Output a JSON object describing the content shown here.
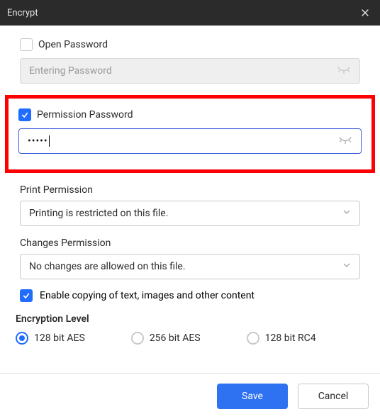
{
  "titlebar": {
    "title": "Encrypt"
  },
  "open_pw": {
    "label": "Open Password",
    "checked": false,
    "placeholder": "Entering Password",
    "value": ""
  },
  "perm_pw": {
    "label": "Permission Password",
    "checked": true,
    "value": "•••••"
  },
  "print_perm": {
    "label": "Print Permission",
    "value": "Printing is restricted on this file."
  },
  "changes_perm": {
    "label": "Changes Permission",
    "value": "No changes are allowed on this file."
  },
  "copy_enable": {
    "label": "Enable copying of text, images and other content",
    "checked": true
  },
  "enc_level": {
    "title": "Encryption Level",
    "options": [
      "128 bit AES",
      "256 bit AES",
      "128 bit RC4"
    ],
    "selected": 0
  },
  "footer": {
    "save": "Save",
    "cancel": "Cancel"
  }
}
